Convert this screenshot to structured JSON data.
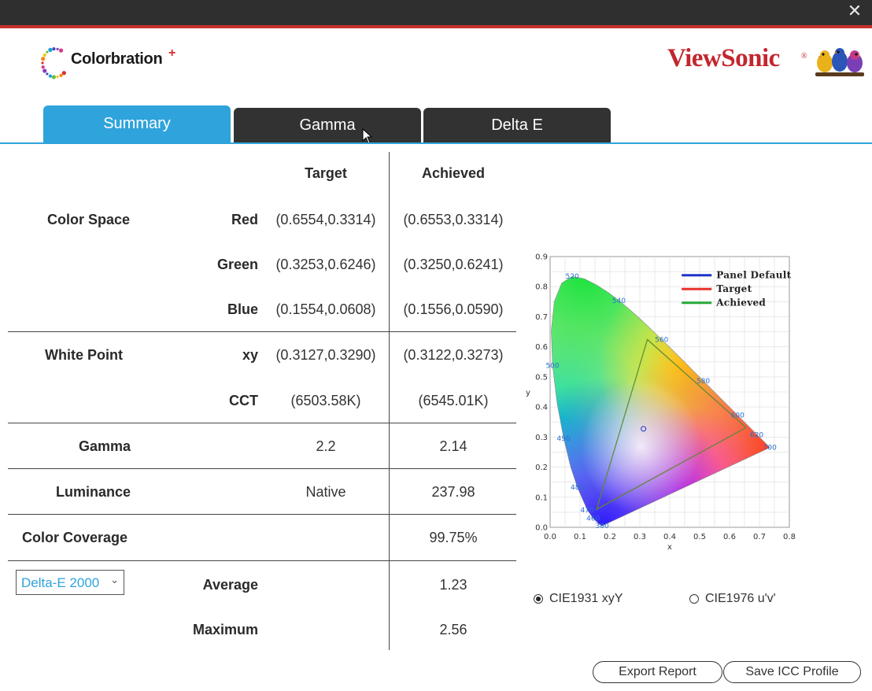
{
  "app": {
    "logo_text": "Colorbration",
    "logo_plus": "+",
    "brand": "ViewSonic",
    "brand_reg": "®",
    "close_glyph": "✕"
  },
  "tabs": [
    {
      "label": "Summary",
      "active": true
    },
    {
      "label": "Gamma",
      "active": false
    },
    {
      "label": "Delta E",
      "active": false
    }
  ],
  "table": {
    "headers": {
      "target": "Target",
      "achieved": "Achieved"
    },
    "color_space": {
      "label": "Color Space",
      "rows": [
        {
          "label": "Red",
          "target": "(0.6554,0.3314)",
          "achieved": "(0.6553,0.3314)"
        },
        {
          "label": "Green",
          "target": "(0.3253,0.6246)",
          "achieved": "(0.3250,0.6241)"
        },
        {
          "label": "Blue",
          "target": "(0.1554,0.0608)",
          "achieved": "(0.1556,0.0590)"
        }
      ]
    },
    "white_point": {
      "label": "White Point",
      "rows": [
        {
          "label": "xy",
          "target": "(0.3127,0.3290)",
          "achieved": "(0.3122,0.3273)"
        },
        {
          "label": "CCT",
          "target": "(6503.58K)",
          "achieved": "(6545.01K)"
        }
      ]
    },
    "gamma": {
      "label": "Gamma",
      "target": "2.2",
      "achieved": "2.14"
    },
    "luminance": {
      "label": "Luminance",
      "target": "Native",
      "achieved": "237.98"
    },
    "coverage": {
      "label": "Color Coverage",
      "achieved": "99.75%"
    },
    "delta_e": {
      "select_value": "Delta-E 2000",
      "average_label": "Average",
      "average": "1.23",
      "maximum_label": "Maximum",
      "maximum": "2.56"
    }
  },
  "chart_data": {
    "type": "scatter",
    "title": "",
    "xlabel": "x",
    "ylabel": "y",
    "xlim": [
      0,
      0.8
    ],
    "ylim": [
      0,
      0.9
    ],
    "x_ticks": [
      "0.0",
      "0.1",
      "0.2",
      "0.3",
      "0.4",
      "0.5",
      "0.6",
      "0.7",
      "0.8"
    ],
    "y_ticks": [
      "0.0",
      "0.1",
      "0.2",
      "0.3",
      "0.4",
      "0.5",
      "0.6",
      "0.7",
      "0.8",
      "0.9"
    ],
    "grid": true,
    "legend_position": "top-right",
    "series": [
      {
        "name": "Panel Default",
        "color": "#1f33c8"
      },
      {
        "name": "Target",
        "color": "#e8322c",
        "points": [
          [
            0.6554,
            0.3314
          ],
          [
            0.3253,
            0.6246
          ],
          [
            0.1554,
            0.0608
          ]
        ]
      },
      {
        "name": "Achieved",
        "color": "#2aaa3a",
        "points": [
          [
            0.6553,
            0.3314
          ],
          [
            0.325,
            0.6241
          ],
          [
            0.1556,
            0.059
          ]
        ]
      }
    ],
    "white_point": [
      0.3122,
      0.3273
    ],
    "wavelength_labels": [
      {
        "text": "520",
        "x": 0.074,
        "y": 0.834
      },
      {
        "text": "540",
        "x": 0.23,
        "y": 0.754
      },
      {
        "text": "560",
        "x": 0.373,
        "y": 0.624
      },
      {
        "text": "580",
        "x": 0.512,
        "y": 0.487
      },
      {
        "text": "600",
        "x": 0.627,
        "y": 0.373
      },
      {
        "text": "620",
        "x": 0.691,
        "y": 0.308
      },
      {
        "text": "700",
        "x": 0.735,
        "y": 0.265
      },
      {
        "text": "500",
        "x": 0.008,
        "y": 0.538
      },
      {
        "text": "490",
        "x": 0.045,
        "y": 0.295
      },
      {
        "text": "480",
        "x": 0.091,
        "y": 0.133
      },
      {
        "text": "470",
        "x": 0.124,
        "y": 0.058
      },
      {
        "text": "460",
        "x": 0.144,
        "y": 0.03
      },
      {
        "text": "380",
        "x": 0.174,
        "y": 0.005
      }
    ]
  },
  "chart_controls": {
    "cie1931": "CIE1931 xyY",
    "cie1976": "CIE1976 u'v'",
    "selected": "cie1931"
  },
  "buttons": {
    "export": "Export Report",
    "save_icc": "Save ICC Profile"
  },
  "colors": {
    "accent": "#2fa3db",
    "brand_red": "#c3262d",
    "tab_dark": "#323232"
  }
}
